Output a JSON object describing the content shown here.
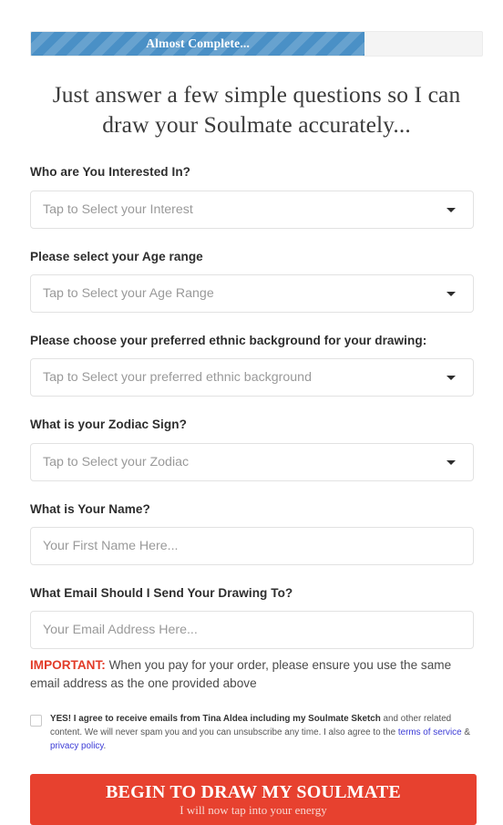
{
  "progress": {
    "label": "Almost Complete...",
    "percent": 74,
    "fill_color": "#4a90c6",
    "track_color": "#f4f4f4"
  },
  "headline": "Just answer a few simple questions so I can draw your Soulmate accurately...",
  "fields": [
    {
      "label": "Who are You Interested In?",
      "type": "select",
      "placeholder": "Tap to Select your Interest",
      "value": ""
    },
    {
      "label": "Please select your Age range",
      "type": "select",
      "placeholder": "Tap to Select your Age Range",
      "value": ""
    },
    {
      "label": "Please choose your preferred ethnic background for your drawing:",
      "type": "select",
      "placeholder": "Tap to Select your preferred ethnic background",
      "value": ""
    },
    {
      "label": "What is your Zodiac Sign?",
      "type": "select",
      "placeholder": "Tap to Select your Zodiac",
      "value": ""
    },
    {
      "label": "What is Your Name?",
      "type": "text",
      "placeholder": "Your First Name Here...",
      "value": ""
    },
    {
      "label": "What Email Should I Send Your Drawing To?",
      "type": "email",
      "placeholder": "Your Email Address Here...",
      "value": ""
    }
  ],
  "note": {
    "prefix": "IMPORTANT:",
    "text": " When you pay for your order, please ensure you use the same email address as the one provided above",
    "prefix_color": "#e23b28"
  },
  "consent": {
    "checked": false,
    "strong_text": "YES! I agree to receive emails from Tina Aldea including my Soulmate Sketch",
    "rest_text": " and other related content. We will never spam you and you can unsubscribe any time. I also agree to the ",
    "link_terms": "terms of service",
    "link_joiner": " & ",
    "link_privacy": "privacy policy",
    "trailing": ".",
    "link_color": "#3b3bd6"
  },
  "cta": {
    "main": "BEGIN TO DRAW MY SOULMATE",
    "sub": "I will now tap into your energy",
    "color": "#e7412f"
  }
}
